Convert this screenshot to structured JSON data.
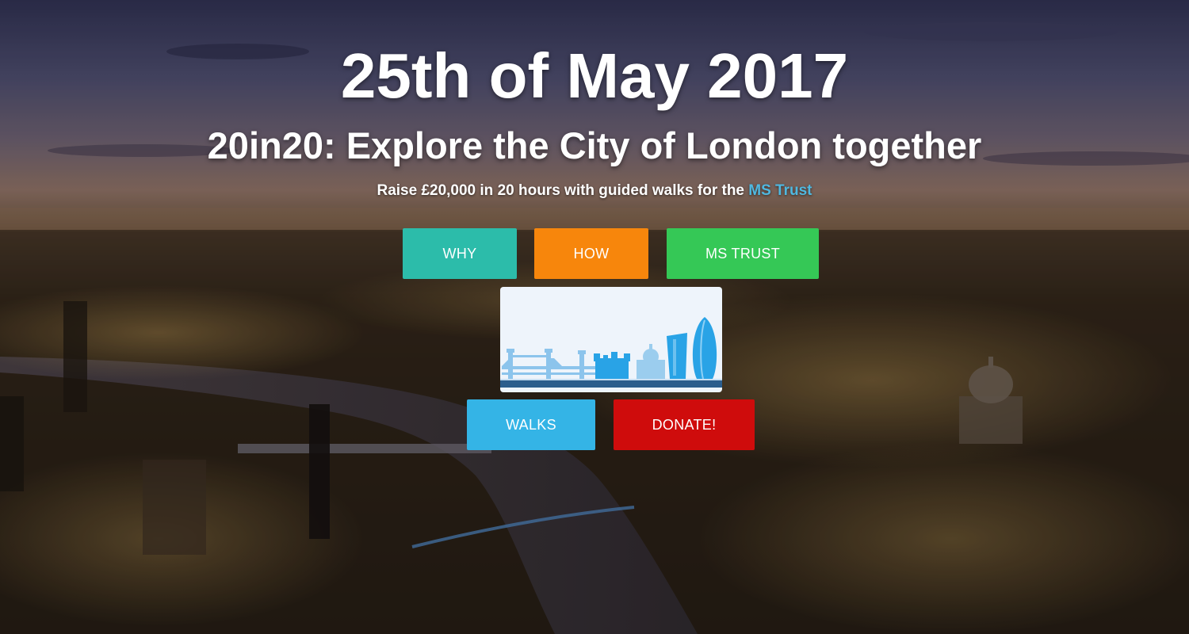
{
  "hero": {
    "date": "25th of May 2017",
    "title": "20in20: Explore the City of London together",
    "tagline_prefix": "Raise £20,000 in 20 hours with guided walks for the ",
    "tagline_link": "MS Trust"
  },
  "nav": {
    "why": "WHY",
    "how": "HOW",
    "ms_trust": "MS TRUST",
    "walks": "WALKS",
    "donate": "DONATE!"
  },
  "logo": {
    "icon": "london-skyline-icon"
  },
  "colors": {
    "why": "#2cbcaa",
    "how": "#f7860c",
    "ms_trust": "#35c856",
    "walks": "#34b4e6",
    "donate": "#cf0c0c",
    "link": "#4fb8e0"
  }
}
